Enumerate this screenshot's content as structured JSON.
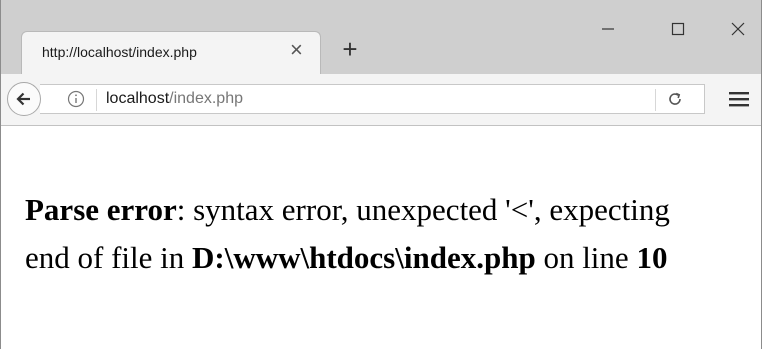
{
  "tab": {
    "title": "http://localhost/index.php"
  },
  "window": {
    "minimize_label": "–",
    "maximize_label": "☐",
    "close_label": "✕"
  },
  "address": {
    "host": "localhost",
    "path": "/index.php"
  },
  "error": {
    "label": "Parse error",
    "message": ": syntax error, unexpected '<', expecting",
    "line2_prefix": "end of file in ",
    "file": "D:\\www\\htdocs\\index.php",
    "line_text": " on line ",
    "line_number": "10"
  },
  "icons": {
    "tab_close": "close-icon",
    "new_tab": "plus-icon",
    "back": "back-arrow-icon",
    "info": "info-icon",
    "reload": "reload-icon",
    "menu": "hamburger-menu-icon"
  },
  "colors": {
    "titlebar": "#cfcfcf",
    "toolbar": "#f4f4f4",
    "tab": "#f4f4f4"
  }
}
